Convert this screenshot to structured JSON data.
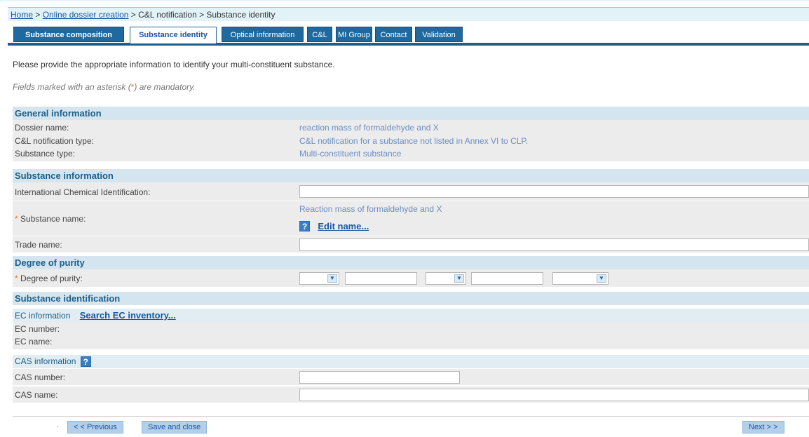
{
  "breadcrumb": {
    "home": "Home",
    "sep1": ">",
    "online": "Online dossier creation",
    "rest": "> C&L notification > Substance identity"
  },
  "tabs": [
    "Substance composition",
    "Substance identity",
    "Optical information",
    "C&L",
    "MI Group",
    "Contact",
    "Validation"
  ],
  "intro": "Please provide the appropriate information to identify your multi-constituent substance.",
  "mandatory": {
    "before": "Fields marked with an asterisk (",
    "ast": "*",
    "after": ") are mandatory."
  },
  "general": {
    "title": "General information",
    "dossier_label": "Dossier name:",
    "dossier_value": "reaction mass of formaldehyde and X",
    "cl_label": "C&L notification type:",
    "cl_value": "C&L notification for a substance not listed in Annex VI to CLP.",
    "type_label": "Substance type:",
    "type_value": "Multi-constituent substance"
  },
  "substance": {
    "title": "Substance information",
    "ici_label": "International Chemical Identification:",
    "name_label": "Substance name:",
    "name_value": "Reaction mass of formaldehyde and X",
    "help": "?",
    "edit_link": "Edit name...",
    "trade_label": "Trade name:",
    "required_mark": "*"
  },
  "purity": {
    "title": "Degree of purity",
    "label": "Degree of purity:",
    "arrow": "▼"
  },
  "identification": {
    "title": "Substance identification",
    "ec_info": "EC information",
    "search_ec": "Search EC inventory...",
    "ec_number_label": "EC number:",
    "ec_name_label": "EC name:",
    "cas_info": "CAS information",
    "cas_number_label": "CAS number:",
    "cas_name_label": "CAS name:"
  },
  "buttons": {
    "dot": ".",
    "previous": "< < Previous",
    "save_close": "Save and close",
    "next": "Next > >"
  }
}
